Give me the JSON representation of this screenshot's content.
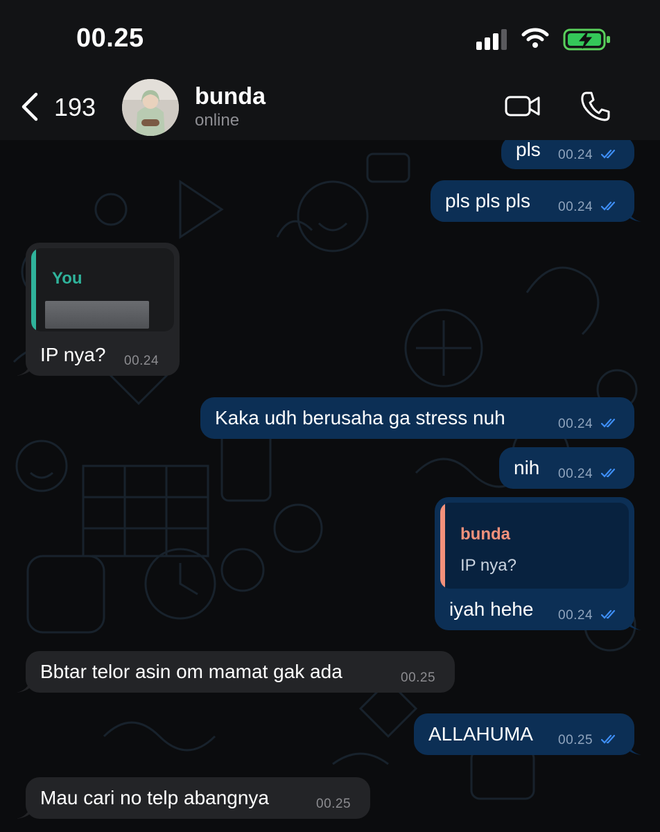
{
  "status_bar": {
    "time": "00.25"
  },
  "header": {
    "back_count": "193",
    "contact_name": "bunda",
    "contact_status": "online"
  },
  "colors": {
    "outgoing_bubble": "#0c2f55",
    "incoming_bubble": "#232427",
    "read_ticks": "#3e8ef7",
    "quote_you": "#2fb39b",
    "quote_bunda": "#f3917b"
  },
  "messages": [
    {
      "direction": "out",
      "text": "pls",
      "time": "00.24",
      "status": "read"
    },
    {
      "direction": "out",
      "text": "pls pls pls",
      "time": "00.24",
      "status": "read"
    },
    {
      "direction": "in",
      "text": "IP nya?",
      "time": "00.24",
      "quote": {
        "sender": "You",
        "text": ""
      }
    },
    {
      "direction": "out",
      "text": "Kaka udh berusaha ga stress nuh",
      "time": "00.24",
      "status": "read"
    },
    {
      "direction": "out",
      "text": "nih",
      "time": "00.24",
      "status": "read"
    },
    {
      "direction": "out",
      "text": "iyah hehe",
      "time": "00.24",
      "status": "read",
      "quote": {
        "sender": "bunda",
        "text": "IP nya?"
      }
    },
    {
      "direction": "in",
      "text": "Bbtar telor asin om mamat gak ada",
      "time": "00.25"
    },
    {
      "direction": "out",
      "text": "ALLAHUMA",
      "time": "00.25",
      "status": "read"
    },
    {
      "direction": "in",
      "text": "Mau cari no telp abangnya",
      "time": "00.25"
    }
  ]
}
